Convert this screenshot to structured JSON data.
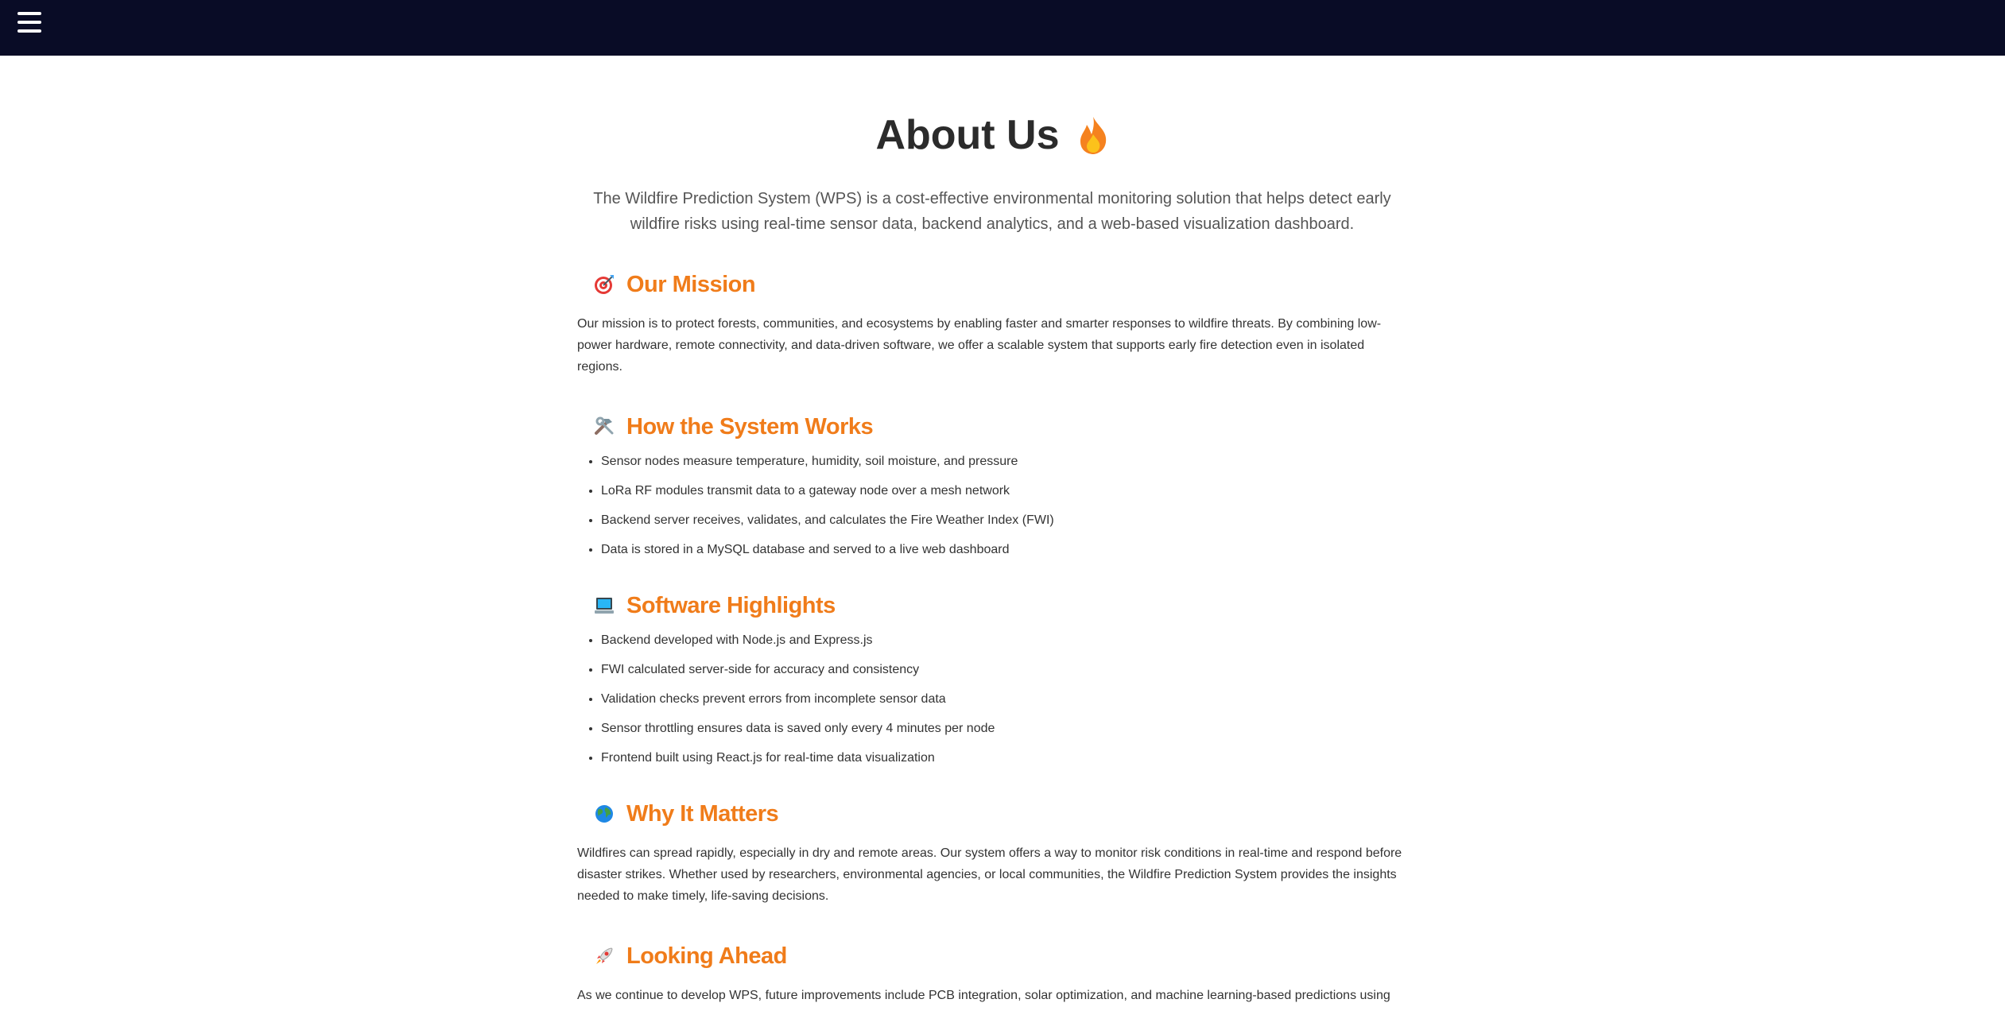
{
  "header": {
    "menu_icon": "hamburger-menu-icon",
    "background": "#090c26"
  },
  "page": {
    "title": "About Us",
    "title_icon": "fire-icon",
    "intro": "The Wildfire Prediction System (WPS) is a cost-effective environmental monitoring solution that helps detect early wildfire risks using real-time sensor data, backend analytics, and a web-based visualization dashboard."
  },
  "accent_color": "#f07c1a",
  "sections": {
    "mission": {
      "icon": "target-icon",
      "title": "Our Mission",
      "text": "Our mission is to protect forests, communities, and ecosystems by enabling faster and smarter responses to wildfire threats. By combining low-power hardware, remote connectivity, and data-driven software, we offer a scalable system that supports early fire detection even in isolated regions."
    },
    "system": {
      "icon": "tools-icon",
      "title": "How the System Works",
      "items": [
        "Sensor nodes measure temperature, humidity, soil moisture, and pressure",
        "LoRa RF modules transmit data to a gateway node over a mesh network",
        "Backend server receives, validates, and calculates the Fire Weather Index (FWI)",
        "Data is stored in a MySQL database and served to a live web dashboard"
      ]
    },
    "software": {
      "icon": "laptop-icon",
      "title": "Software Highlights",
      "items": [
        "Backend developed with Node.js and Express.js",
        "FWI calculated server-side for accuracy and consistency",
        "Validation checks prevent errors from incomplete sensor data",
        "Sensor throttling ensures data is saved only every 4 minutes per node",
        "Frontend built using React.js for real-time data visualization"
      ]
    },
    "matters": {
      "icon": "globe-icon",
      "title": "Why It Matters",
      "text": "Wildfires can spread rapidly, especially in dry and remote areas. Our system offers a way to monitor risk conditions in real-time and respond before disaster strikes. Whether used by researchers, environmental agencies, or local communities, the Wildfire Prediction System provides the insights needed to make timely, life-saving decisions."
    },
    "ahead": {
      "icon": "rocket-icon",
      "title": "Looking Ahead",
      "text": "As we continue to develop WPS, future improvements include PCB integration, solar optimization, and machine learning-based predictions using"
    }
  }
}
